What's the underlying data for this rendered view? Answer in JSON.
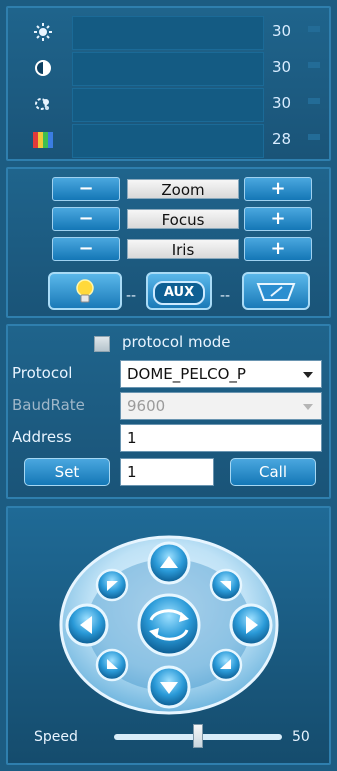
{
  "image_adjust": {
    "brightness": {
      "icon": "brightness-icon",
      "value": "30"
    },
    "contrast": {
      "icon": "contrast-icon",
      "value": "30"
    },
    "saturation": {
      "icon": "saturation-icon",
      "value": "30"
    },
    "hue": {
      "icon": "color-bars-icon",
      "value": "28"
    }
  },
  "ptz": {
    "minus_label": "−",
    "plus_label": "+",
    "zoom_label": "Zoom",
    "focus_label": "Focus",
    "iris_label": "Iris",
    "light_icon": "light-bulb-icon",
    "aux_label": "AUX",
    "wiper_icon": "wiper-icon",
    "dash": "--"
  },
  "protocol": {
    "protocol_mode_label": "protocol mode",
    "protocol_label": "Protocol",
    "protocol_value": "DOME_PELCO_P",
    "baudrate_label": "BaudRate",
    "baudrate_value": "9600",
    "address_label": "Address",
    "address_value": "1",
    "set_label": "Set",
    "preset_value": "1",
    "call_label": "Call"
  },
  "joystick": {
    "speed_label": "Speed",
    "speed_value": "50",
    "speed_level": 0.5
  },
  "colors": {
    "panel_bg": "#1c5c82",
    "button_blue": "#1477b6",
    "accent": "#4aa7df"
  }
}
